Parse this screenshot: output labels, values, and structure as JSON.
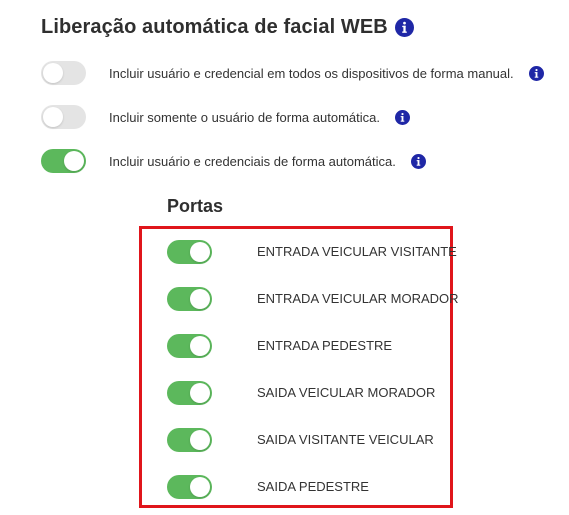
{
  "header": {
    "title": "Liberação automática de facial WEB",
    "info_icon": "info-circle-icon"
  },
  "options": [
    {
      "label": "Incluir usuário e credencial em todos os dispositivos de forma manual.",
      "enabled": false,
      "icon": "info-circle-icon"
    },
    {
      "label": "Incluir somente o usuário de forma automática.",
      "enabled": false,
      "icon": "info-circle-icon"
    },
    {
      "label": "Incluir usuário e credenciais de forma automática.",
      "enabled": true,
      "icon": "info-circle-icon"
    }
  ],
  "doors": {
    "title": "Portas",
    "highlight_color": "#e0151b",
    "items": [
      {
        "label": "ENTRADA VEICULAR VISITANTE",
        "enabled": true
      },
      {
        "label": "ENTRADA VEICULAR MORADOR",
        "enabled": true
      },
      {
        "label": "ENTRADA PEDESTRE",
        "enabled": true
      },
      {
        "label": "SAIDA VEICULAR MORADOR",
        "enabled": true
      },
      {
        "label": "SAIDA VISITANTE VEICULAR",
        "enabled": true
      },
      {
        "label": "SAIDA PEDESTRE",
        "enabled": true
      }
    ]
  },
  "colors": {
    "toggle_on": "#5cb85c",
    "toggle_off": "#e4e4e4",
    "info_icon": "#1f27a6"
  }
}
